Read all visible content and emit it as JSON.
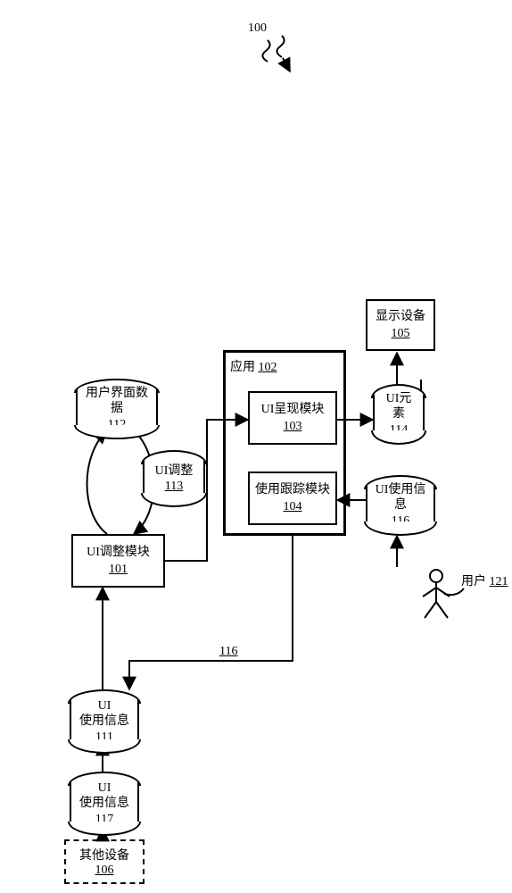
{
  "fig": {
    "ref": "100"
  },
  "ui_data": {
    "title": "用户界面数据",
    "num": "112"
  },
  "ui_adjust_scroll": {
    "title": "UI调整",
    "num": "113"
  },
  "ui_usage_info_111": {
    "title_l1": "UI",
    "title_l2": "使用信息",
    "num": "111"
  },
  "ui_usage_info_117": {
    "title_l1": "UI",
    "title_l2": "使用信息",
    "num": "117"
  },
  "ui_elements": {
    "title": "UI元素",
    "num": "114"
  },
  "ui_usage_info_116": {
    "title": "UI使用信息",
    "num": "116"
  },
  "ui_adjust_module": {
    "title": "UI调整模块",
    "num": "101"
  },
  "app": {
    "title": "应用",
    "num": "102"
  },
  "present_module": {
    "title": "UI呈现模块",
    "num": "103"
  },
  "track_module": {
    "title": "使用跟踪模块",
    "num": "104"
  },
  "display_device": {
    "title": "显示设备",
    "num": "105"
  },
  "other_device": {
    "title": "其他设备",
    "num": "106"
  },
  "user": {
    "title": "用户",
    "num": "121"
  },
  "edge_label_116": "116"
}
